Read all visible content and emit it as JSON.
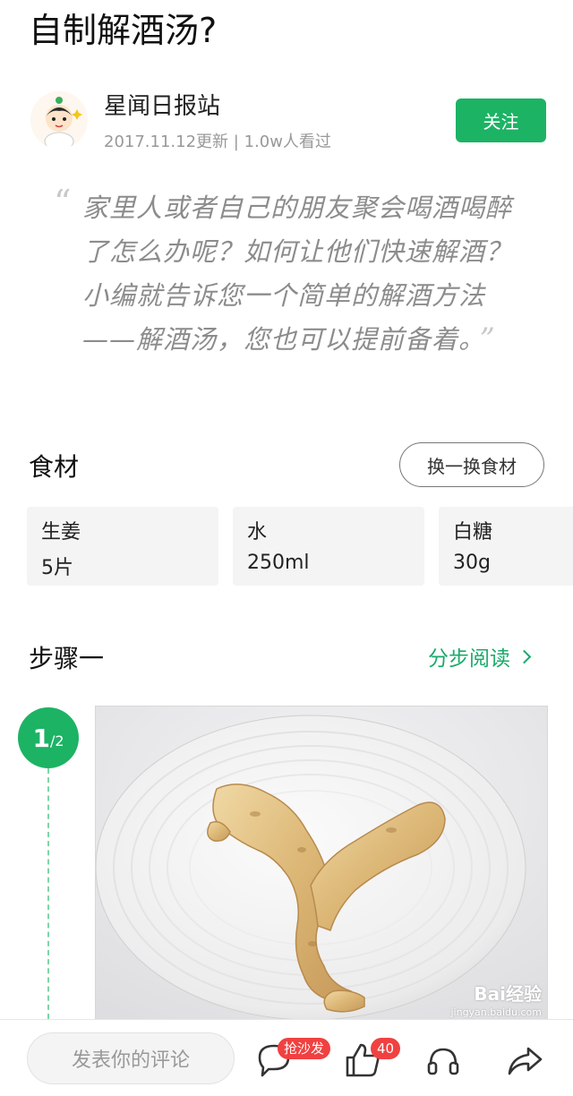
{
  "article": {
    "title": "自制解酒汤?",
    "author": "星闻日报站",
    "meta": "2017.11.12更新 | 1.0w人看过",
    "follow_label": "关注",
    "quote_open": "“",
    "quote_close": "”",
    "intro": "家里人或者自己的朋友聚会喝酒喝醉了怎么办呢？如何让他们快速解酒？小编就告诉您一个简单的解酒方法——解酒汤，您也可以提前备着。"
  },
  "ingredients": {
    "title": "食材",
    "swap_label": "换一换食材",
    "items": [
      {
        "name": "生姜",
        "amount": "5片"
      },
      {
        "name": "水",
        "amount": "250ml"
      },
      {
        "name": "白糖",
        "amount": "30g"
      }
    ]
  },
  "step": {
    "title": "步骤一",
    "read_label": "分步阅读",
    "index": "1",
    "total": "/2",
    "watermark_logo": "Bai经验",
    "watermark_url": "jingyan.baidu.com"
  },
  "bottom_bar": {
    "comment_placeholder": "发表你的评论",
    "comment_badge": "抢沙发",
    "like_count": "40"
  },
  "colors": {
    "accent": "#1cb364",
    "link": "#1aaa6a",
    "badge": "#f04141"
  },
  "icons": [
    "comment-icon",
    "like-icon",
    "headphones-icon",
    "share-icon",
    "chevron-right-icon"
  ]
}
